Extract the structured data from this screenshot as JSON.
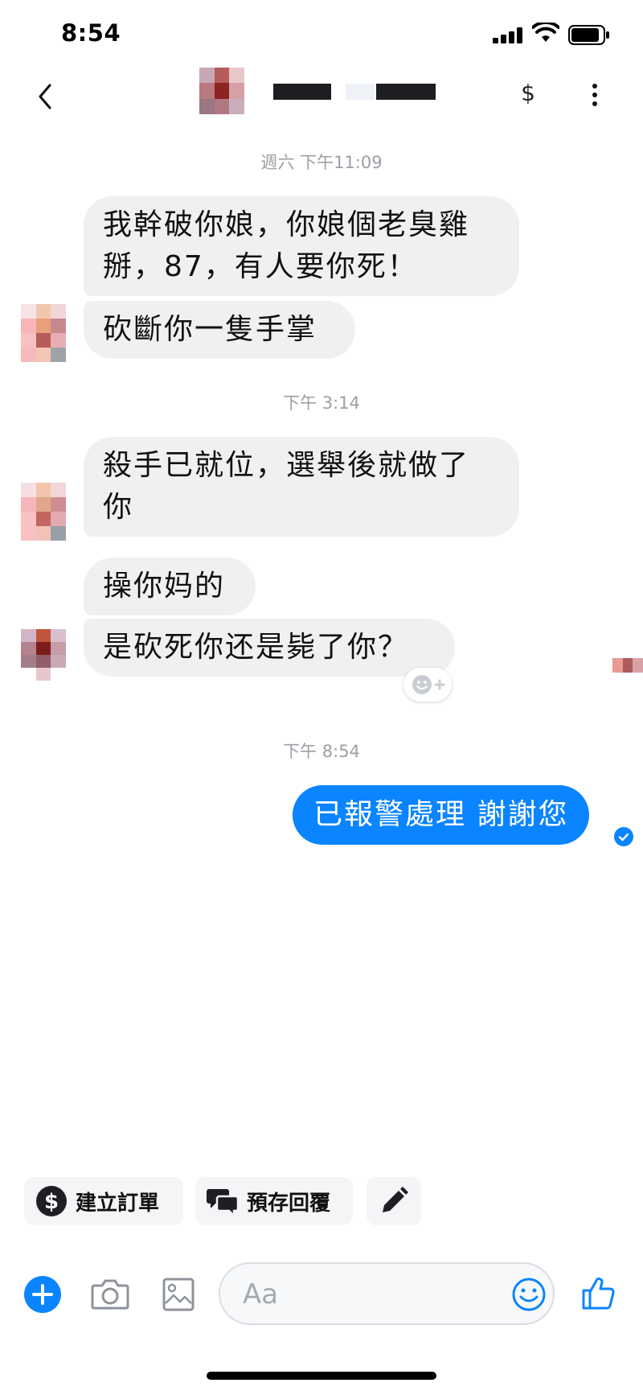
{
  "status_bar": {
    "time": "8:54"
  },
  "header": {
    "currency_symbol": "$"
  },
  "messages": [
    {
      "timestamp": "週六 下午11:09"
    },
    {
      "incoming": [
        "我幹破你娘，你娘個老臭雞",
        "掰，87，有人要你死！",
        "砍斷你一隻手掌"
      ]
    },
    {
      "timestamp": "下午 3:14"
    },
    {
      "incoming": [
        "殺手已就位，選舉後就做了",
        "你",
        "操你妈的",
        "是砍死你还是毙了你？"
      ]
    },
    {
      "timestamp": "下午 8:54"
    },
    {
      "outgoing": "已報警處理 謝謝您"
    }
  ],
  "quick_actions": [
    {
      "label": "建立訂單",
      "icon": "dollar-circle-icon"
    },
    {
      "label": "預存回覆",
      "icon": "chat-bubbles-icon"
    },
    {
      "label": "",
      "icon": "pencil-icon"
    }
  ],
  "composer": {
    "placeholder": "Aa"
  },
  "colors": {
    "accent": "#0a84ff",
    "incoming_bubble": "#f0f0f0",
    "timestamp": "#9b9fa5"
  }
}
